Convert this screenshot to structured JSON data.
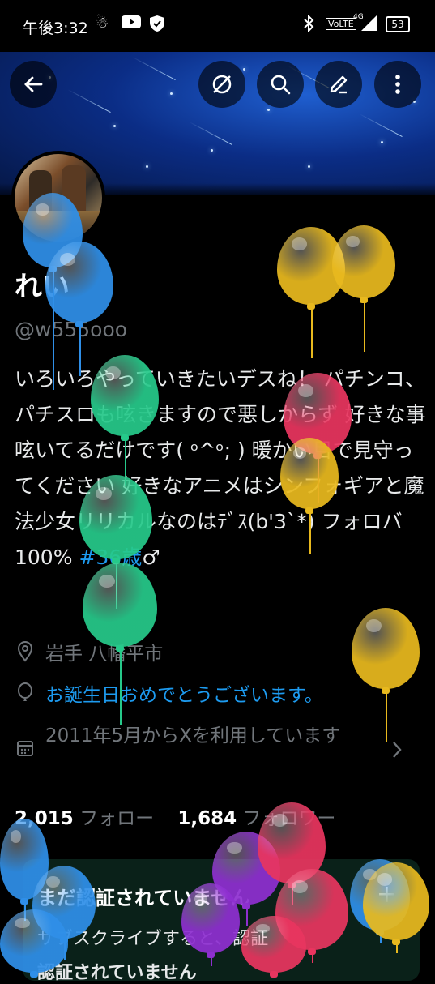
{
  "status_bar": {
    "time": "午後3:32",
    "network": "VoLTE",
    "signal_type": "4G",
    "battery": "53"
  },
  "toolbar": {
    "back_icon": "back-arrow-icon",
    "mute_icon": "mute-icon",
    "search_icon": "search-icon",
    "edit_icon": "edit-icon",
    "more_icon": "more-vertical-icon"
  },
  "profile": {
    "name": "れい",
    "handle": "@w555ooo",
    "bio_text": "いろいろやっていきたいデスね！ パチンコ、パチスロも呟きますので悪しからず 好きな事呟いてるだけです( ᵒ^ᵒ; ) 暖かい目で見守ってください 好きなアニメはシンフォギアと魔法少女リリカルなのはﾃﾞｽ(b'3`*) フォロバ100%",
    "bio_hashtag": "#36歳",
    "bio_suffix": "♂",
    "location": "岩手 八幡平市",
    "birthday": "お誕生日おめでとうございます。",
    "joined": "2011年5月からXを利用しています",
    "following_count": "2,015",
    "following_label": "フォロー",
    "followers_count": "1,684",
    "followers_label": "フォロワー"
  },
  "verify_card": {
    "title": "まだ認証されていません",
    "line1": "サブスクライブすると、認証",
    "line2": "認証されていません",
    "plus": "+"
  },
  "colors": {
    "accent": "#1d9bf0",
    "balloon_blue": "#2f8fe8",
    "balloon_gold": "#e8b91e",
    "balloon_green": "#26c98a",
    "balloon_pink": "#e8355f",
    "balloon_purple": "#8e2fd0"
  }
}
